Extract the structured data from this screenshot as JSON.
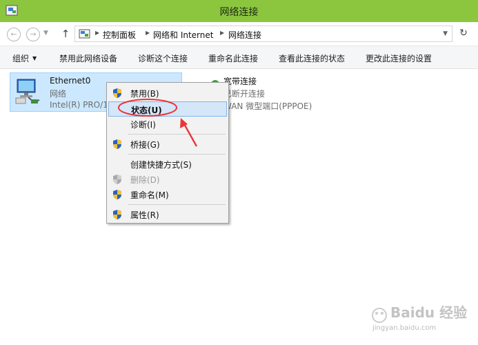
{
  "window": {
    "title": "网络连接"
  },
  "address": {
    "crumbs": [
      "控制面板",
      "网络和 Internet",
      "网络连接"
    ]
  },
  "toolbar": {
    "organize": "组织",
    "disable": "禁用此网络设备",
    "diagnose": "诊断这个连接",
    "rename": "重命名此连接",
    "status": "查看此连接的状态",
    "settings": "更改此连接的设置"
  },
  "connections": [
    {
      "name": "Ethernet0",
      "status": "网络",
      "device": "Intel(R) PRO/1000"
    },
    {
      "name": "宽带连接",
      "status": "已断开连接",
      "device": "WAN 微型端口(PPPOE)"
    }
  ],
  "context_menu": {
    "items": [
      {
        "label": "禁用(B)",
        "shield": true,
        "disabled": false
      },
      {
        "label": "状态(U)",
        "shield": false,
        "disabled": false,
        "highlighted": true
      },
      {
        "label": "诊断(I)",
        "shield": false,
        "disabled": false
      },
      {
        "label": "桥接(G)",
        "shield": true,
        "disabled": false
      },
      {
        "label": "创建快捷方式(S)",
        "shield": false,
        "disabled": false
      },
      {
        "label": "删除(D)",
        "shield": true,
        "disabled": true
      },
      {
        "label": "重命名(M)",
        "shield": true,
        "disabled": false
      },
      {
        "label": "属性(R)",
        "shield": true,
        "disabled": false
      }
    ]
  },
  "watermark": {
    "brand": "Baidu 经验",
    "url": "jingyan.baidu.com"
  },
  "colors": {
    "titlebar": "#8cc63e",
    "selection": "#cce8ff",
    "annotation": "#e8353a"
  }
}
